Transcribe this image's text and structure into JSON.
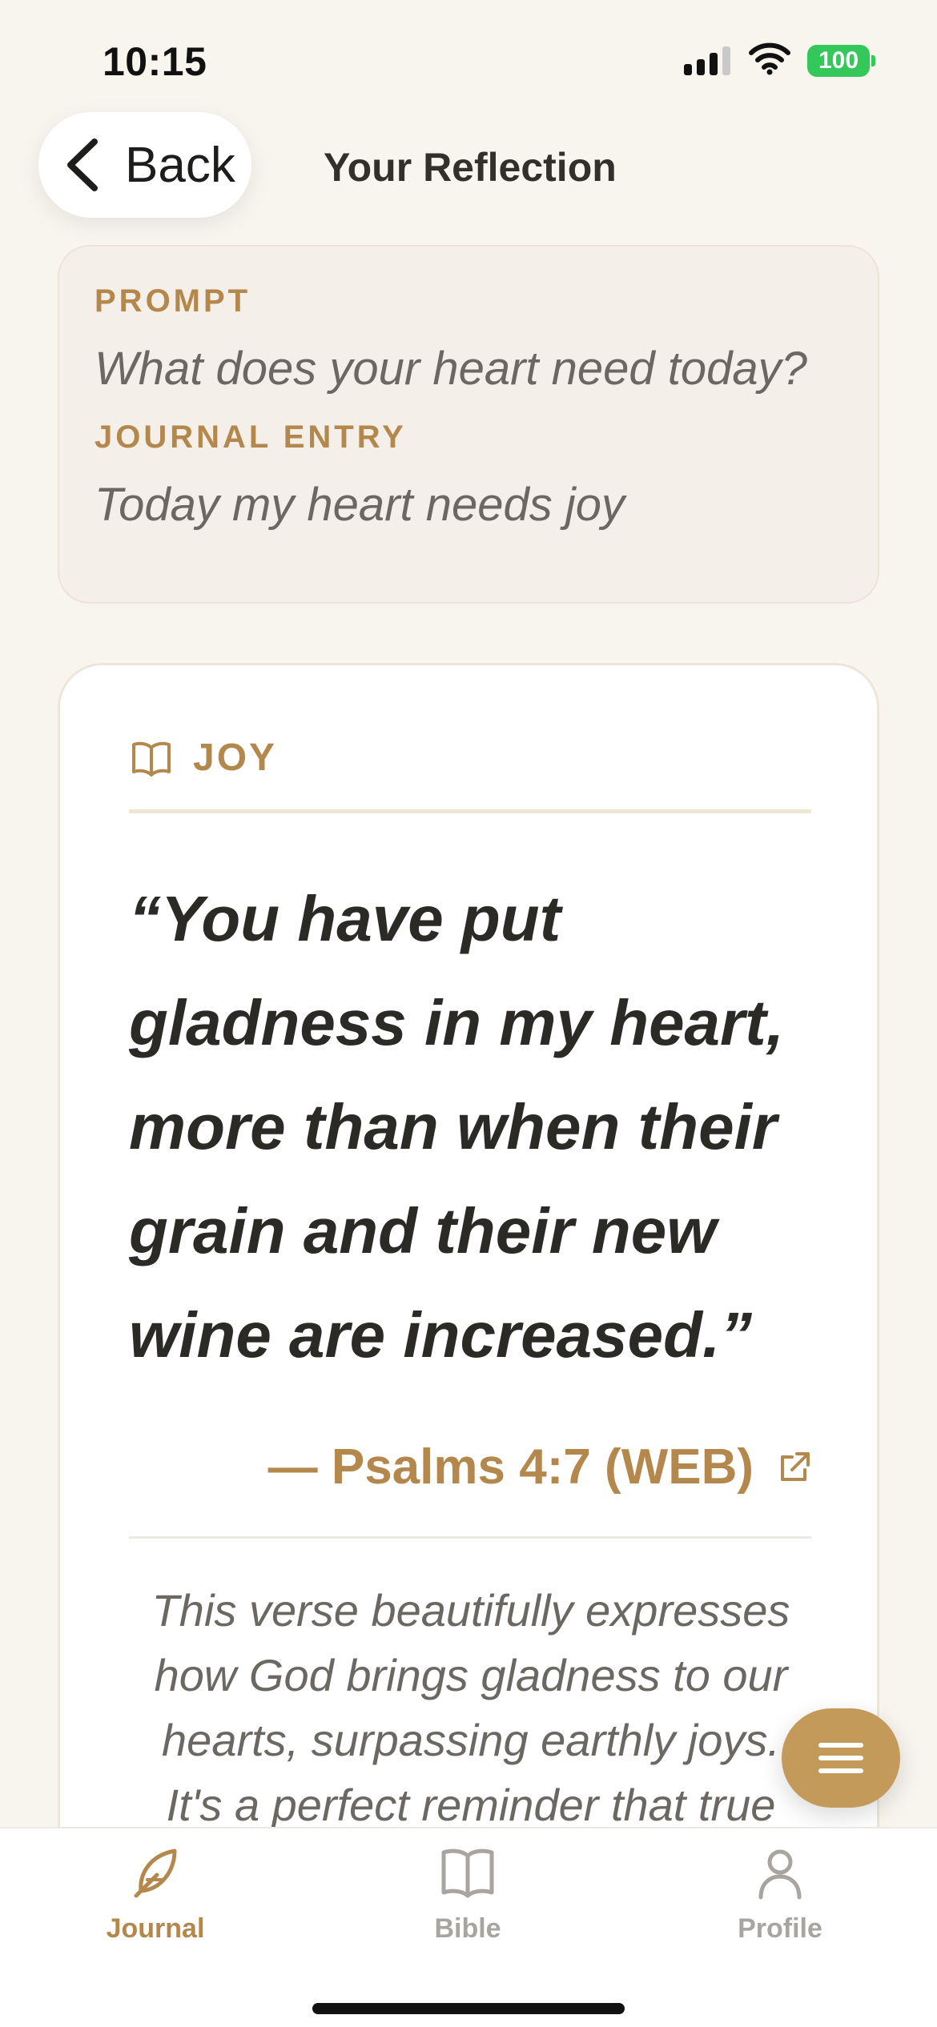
{
  "status": {
    "time": "10:15",
    "battery": "100"
  },
  "header": {
    "back_label": "Back",
    "title": "Your Reflection"
  },
  "prompt_card": {
    "prompt_label": "PROMPT",
    "prompt_text": "What does your heart need today?",
    "entry_label": "JOURNAL ENTRY",
    "entry_text": "Today my heart needs joy"
  },
  "verse_card": {
    "topic_icon": "open-book-icon",
    "topic": "JOY",
    "verse": "“You have put gladness in my heart, more than when their grain and their new wine are increased.”",
    "reference": "— Psalms 4:7 (WEB)",
    "reference_icon": "external-link-icon",
    "reflection": "This verse beautifully expresses how God brings gladness to our hearts, surpassing earthly joys. It's a perfect reminder that true"
  },
  "fab": {
    "icon": "menu-icon"
  },
  "tabs": [
    {
      "label": "Journal",
      "icon": "feather-icon",
      "active": true
    },
    {
      "label": "Bible",
      "icon": "book-icon",
      "active": false
    },
    {
      "label": "Profile",
      "icon": "person-icon",
      "active": false
    }
  ],
  "colors": {
    "accent": "#b4884d",
    "fab": "#c49a5a",
    "inactive": "#a8a5a0",
    "background": "#f8f5ef"
  }
}
